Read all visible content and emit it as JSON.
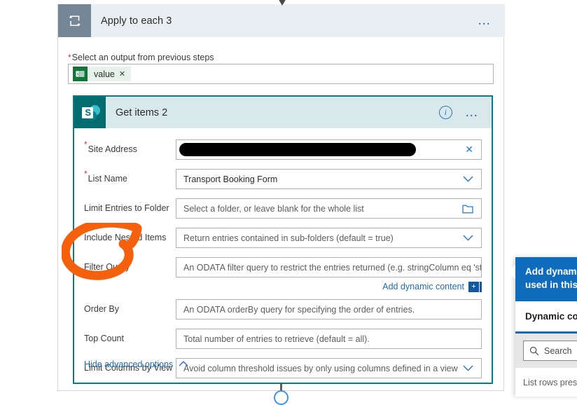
{
  "scope": {
    "title": "Apply to each 3",
    "icon": "loop-icon",
    "menu_label": "…",
    "field": {
      "label": "Select an output from previous steps",
      "required_marker": "*",
      "token": {
        "icon": "excel-icon",
        "label": "value",
        "remove": "✕"
      }
    }
  },
  "action": {
    "title": "Get items 2",
    "icon": "sharepoint-icon",
    "info_label": "i",
    "menu_label": "…",
    "fields": [
      {
        "label": "Site Address",
        "required": true,
        "value": "",
        "placeholder": "",
        "redacted": true,
        "adornment": "clear-icon",
        "adornment_glyph": "✕"
      },
      {
        "label": "List Name",
        "required": true,
        "value": "Transport Booking Form",
        "placeholder": "",
        "redacted": false,
        "adornment": "chevron-down-icon",
        "adornment_glyph": "⌄"
      },
      {
        "label": "Limit Entries to Folder",
        "required": false,
        "value": "",
        "placeholder": "Select a folder, or leave blank for the whole list",
        "redacted": false,
        "adornment": "folder-icon",
        "adornment_glyph": ""
      },
      {
        "label": "Include Nested Items",
        "required": false,
        "value": "",
        "placeholder": "Return entries contained in sub-folders (default = true)",
        "redacted": false,
        "adornment": "chevron-down-icon",
        "adornment_glyph": "⌄"
      },
      {
        "label": "Filter Query",
        "required": false,
        "value": "",
        "placeholder": "An ODATA filter query to restrict the entries returned (e.g. stringColumn eq 'stri",
        "redacted": false,
        "adornment": "none",
        "adornment_glyph": ""
      },
      {
        "label": "Order By",
        "required": false,
        "value": "",
        "placeholder": "An ODATA orderBy query for specifying the order of entries.",
        "redacted": false,
        "adornment": "none",
        "adornment_glyph": ""
      },
      {
        "label": "Top Count",
        "required": false,
        "value": "",
        "placeholder": "Total number of entries to retrieve (default = all).",
        "redacted": false,
        "adornment": "none",
        "adornment_glyph": ""
      },
      {
        "label": "Limit Columns by View",
        "required": false,
        "value": "",
        "placeholder": "Avoid column threshold issues by only using columns defined in a view",
        "redacted": false,
        "adornment": "chevron-down-icon",
        "adornment_glyph": "⌄"
      }
    ],
    "add_dynamic_content": {
      "label": "Add dynamic content",
      "plus": "+"
    },
    "hide_advanced": {
      "label": "Hide advanced options",
      "chevron": "⌃"
    }
  },
  "flyout": {
    "banner_line1": "Add dynamic c",
    "banner_line2": "used in this flo",
    "tab_label": "Dynamic cont",
    "search_placeholder": "Search",
    "search_icon": "search-icon",
    "group_label": "List rows prese"
  },
  "colors": {
    "scope_header_bg": "#e9eef2",
    "scope_icon_bg": "#758697",
    "action_header_bg": "#d9e8ea",
    "action_border": "#0a7b83",
    "sharepoint_teal": "#036c70",
    "excel_green": "#127436",
    "link_blue": "#1f6bb8",
    "flyout_blue": "#0f6cbd",
    "required_red": "#d13438",
    "annotation_orange": "#f4600c",
    "redaction_black": "#000000"
  }
}
